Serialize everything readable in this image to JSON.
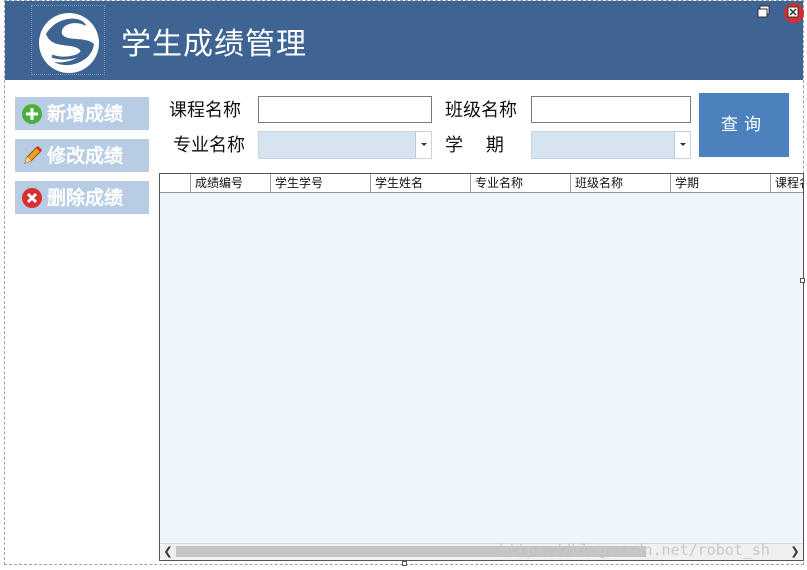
{
  "header": {
    "title": "学生成绩管理",
    "background": "#3e6494"
  },
  "sidebar": {
    "items": [
      {
        "label": "新增成绩",
        "icon": "plus-circle-icon"
      },
      {
        "label": "修改成绩",
        "icon": "pencil-icon"
      },
      {
        "label": "删除成绩",
        "icon": "x-circle-icon"
      }
    ]
  },
  "filters": {
    "course_label": "课程名称",
    "course_value": "",
    "class_label": "班级名称",
    "class_value": "",
    "major_label": "专业名称",
    "major_value": "",
    "term_label": "学    期",
    "term_value": ""
  },
  "query_button": "查询",
  "grid": {
    "columns": [
      "成绩编号",
      "学生学号",
      "学生姓名",
      "专业名称",
      "班级名称",
      "学期",
      "课程名称"
    ],
    "rows": []
  },
  "watermark": "https://blog.csdn.net/robot_sh"
}
